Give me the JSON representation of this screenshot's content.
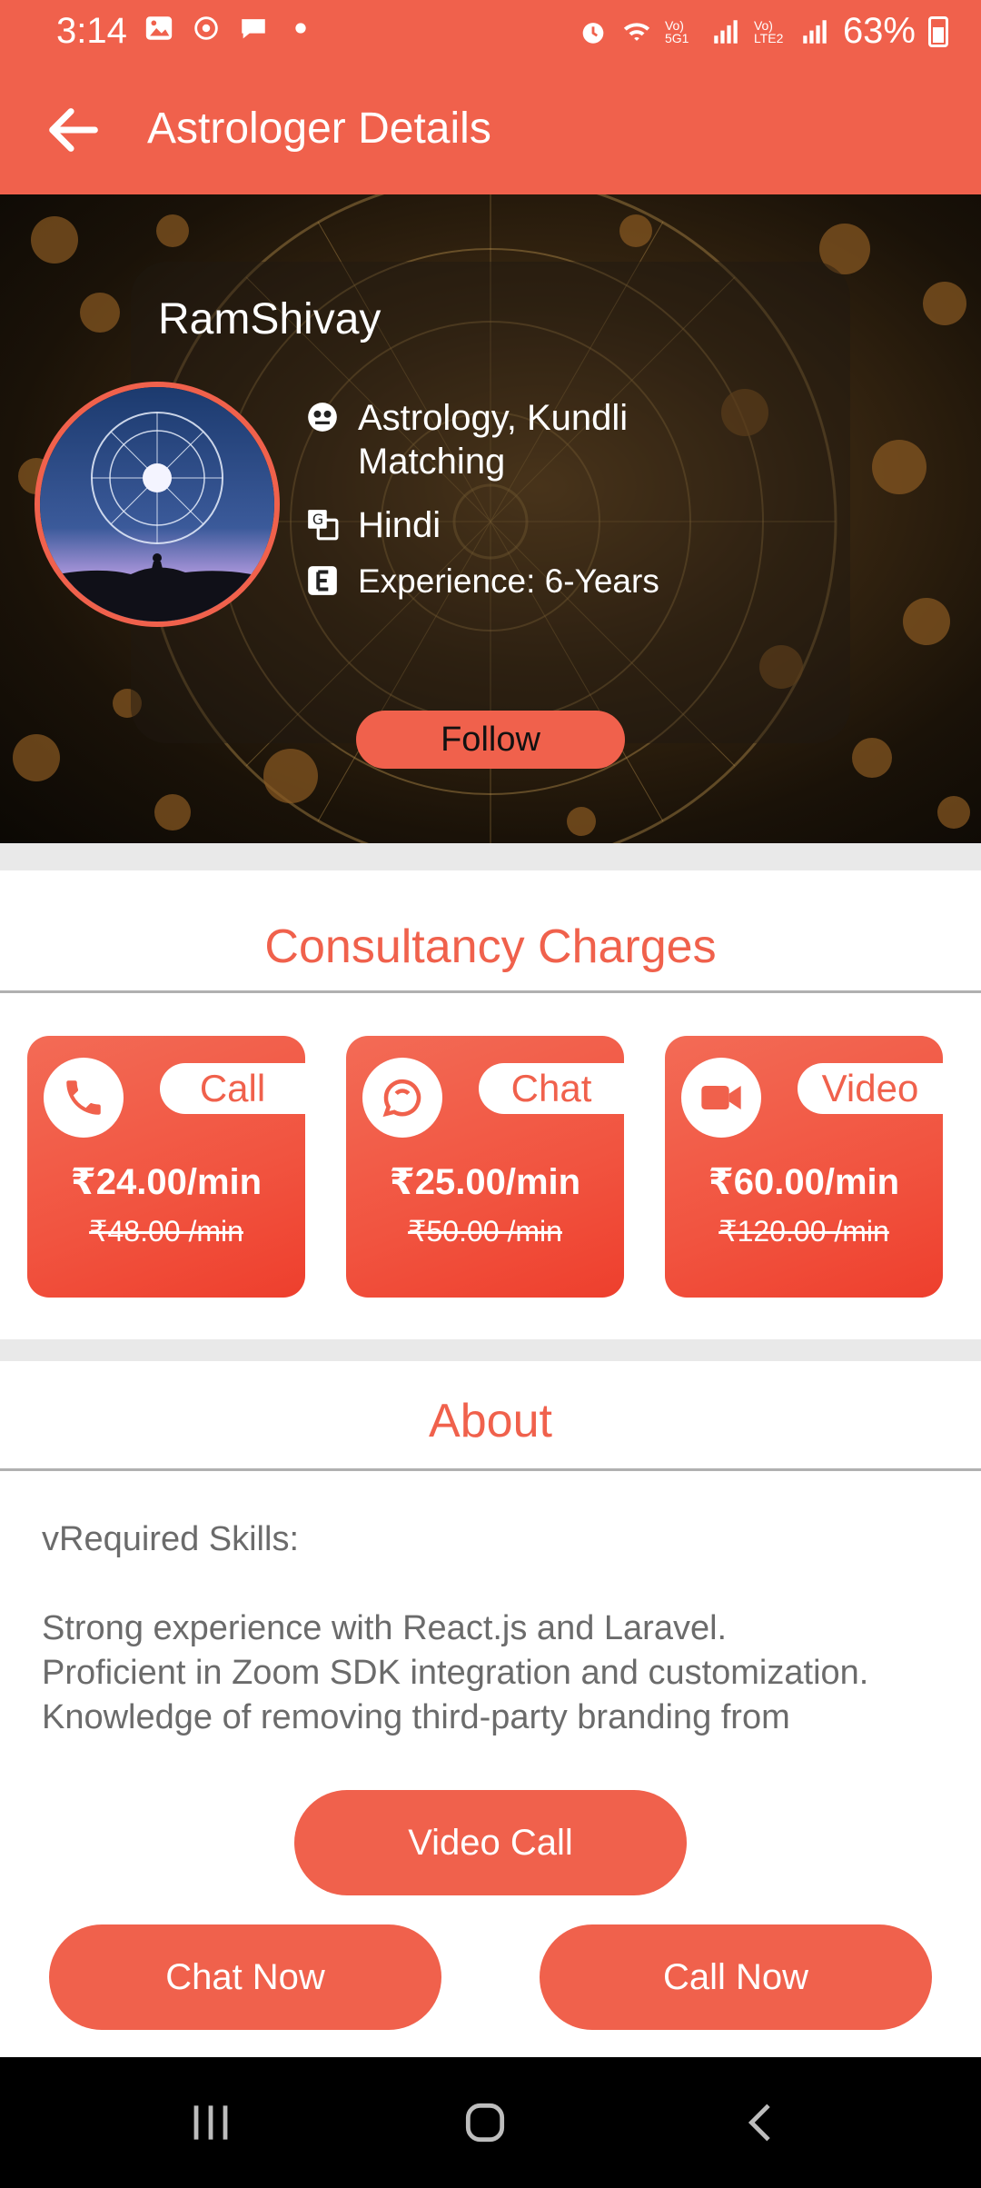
{
  "status_bar": {
    "time": "3:14",
    "battery": "63%",
    "net1": "Vo) 5G1",
    "net2": "Vo) LTE2"
  },
  "app_bar": {
    "title": "Astrologer Details"
  },
  "profile": {
    "name": "RamShivay",
    "skills": "Astrology, Kundli Matching",
    "language": "Hindi",
    "experience": "Experience: 6-Years",
    "follow_label": "Follow"
  },
  "charges": {
    "title": "Consultancy Charges",
    "items": [
      {
        "label": "Call",
        "price": "₹24.00/min",
        "old_price": "₹48.00 /min",
        "icon": "phone-icon"
      },
      {
        "label": "Chat",
        "price": "₹25.00/min",
        "old_price": "₹50.00 /min",
        "icon": "chat-icon"
      },
      {
        "label": "Video",
        "price": "₹60.00/min",
        "old_price": "₹120.00 /min",
        "icon": "video-camera-icon"
      }
    ]
  },
  "about": {
    "title": "About",
    "text": "vRequired Skills:\n\nStrong experience with React.js and Laravel.\nProficient in Zoom SDK integration and customization.\nKnowledge of removing third-party branding from"
  },
  "actions": {
    "video_call": "Video Call",
    "chat_now": "Chat Now",
    "call_now": "Call Now"
  },
  "colors": {
    "accent": "#F0614C",
    "text_gray": "#6b6b6b",
    "band_gray": "#e9e9e9"
  }
}
